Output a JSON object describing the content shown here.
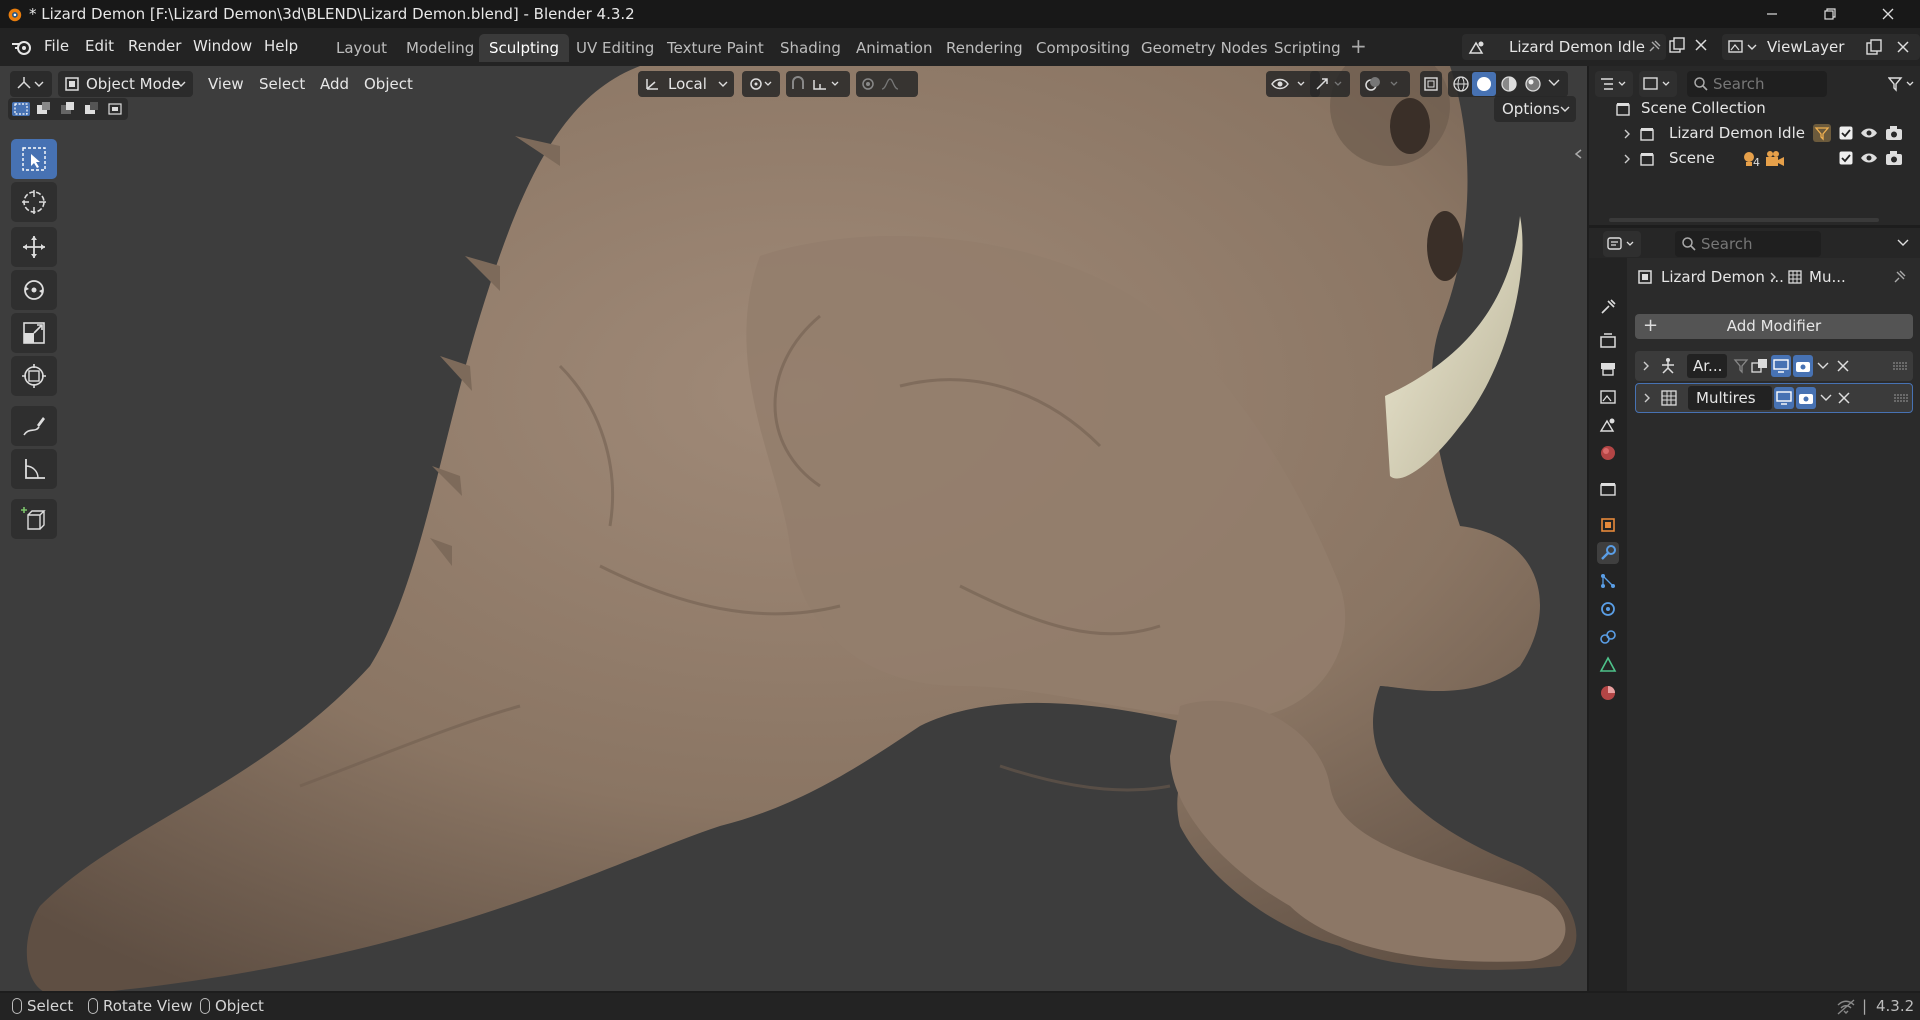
{
  "window": {
    "title": "* Lizard Demon [F:\\Lizard Demon\\3d\\BLEND\\Lizard Demon.blend] - Blender 4.3.2"
  },
  "menu": {
    "items": [
      "File",
      "Edit",
      "Render",
      "Window",
      "Help"
    ]
  },
  "workspaces": [
    "Layout",
    "Modeling",
    "Sculpting",
    "UV Editing",
    "Texture Paint",
    "Shading",
    "Animation",
    "Rendering",
    "Compositing",
    "Geometry Nodes",
    "Scripting"
  ],
  "active_workspace": "Sculpting",
  "scene_selector": "Lizard Demon Idle",
  "view_layer": "ViewLayer",
  "viewport": {
    "mode": "Object Mode",
    "menus": [
      "View",
      "Select",
      "Add",
      "Object"
    ],
    "transform_orientation": "Local",
    "options_label": "Options"
  },
  "outliner": {
    "search_placeholder": "Search",
    "root": "Scene Collection",
    "rows": [
      {
        "label": "Lizard Demon Idle"
      },
      {
        "label": "Scene",
        "badge": "4"
      }
    ]
  },
  "properties": {
    "search_placeholder": "Search",
    "breadcrumb_object": "Lizard Demon ...",
    "breadcrumb_modifier": "Mu...",
    "add_modifier": "Add Modifier",
    "modifiers": [
      {
        "name": "Ar..."
      },
      {
        "name": "Multires"
      }
    ]
  },
  "status": {
    "select": "Select",
    "rotate": "Rotate View",
    "object": "Object",
    "version": "4.3.2"
  },
  "colors": {
    "accent": "#4772b3",
    "skin": "#8f7a69",
    "horn": "#d8d4bc"
  }
}
